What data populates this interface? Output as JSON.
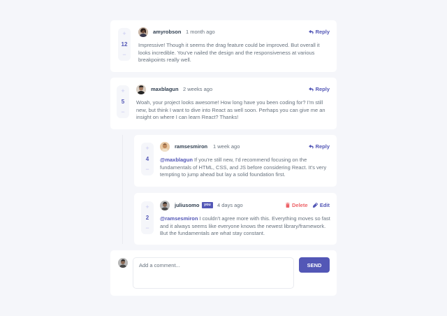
{
  "comments": [
    {
      "username": "amyrobson",
      "date": "1 month ago",
      "score": "12",
      "text": "Impressive! Though it seems the drag feature could be improved. But overall it looks incredible. You've nailed the design and the responsiveness at various breakpoints really well.",
      "reply_label": "Reply"
    },
    {
      "username": "maxblagun",
      "date": "2 weeks ago",
      "score": "5",
      "text": "Woah, your project looks awesome! How long have you been coding for? I'm still new, but think I want to dive into React as well soon. Perhaps you can give me an insight on where I can learn React? Thanks!",
      "reply_label": "Reply"
    }
  ],
  "replies": [
    {
      "username": "ramsesmiron",
      "date": "1 week ago",
      "score": "4",
      "mention": "@maxblagun",
      "text": " If you're still new, I'd recommend focusing on the fundamentals of HTML, CSS, and JS before considering React. It's very tempting to jump ahead but lay a solid foundation first.",
      "reply_label": "Reply"
    },
    {
      "username": "juliusomo",
      "you_badge": "you",
      "date": "4 days ago",
      "score": "2",
      "mention": "@ramsesmiron",
      "text": " I couldn't agree more with this. Everything moves so fast and it always seems like everyone knows the newest library/framework. But the fundamentals are what stay constant.",
      "delete_label": "Delete",
      "edit_label": "Edit"
    }
  ],
  "composer": {
    "placeholder": "Add a comment...",
    "send_label": "SEND"
  },
  "vote": {
    "plus": "+",
    "minus": "−"
  },
  "colors": {
    "background": "#f5f6fa",
    "card": "#ffffff",
    "accent": "#5357b6",
    "accent_light": "#c5c6ef",
    "danger": "#ed6368",
    "heading": "#324152",
    "body_text": "#67727e"
  },
  "icons": {
    "reply": "reply-arrow-icon",
    "delete": "trash-icon",
    "edit": "pencil-icon",
    "avatar": "user-avatar"
  }
}
